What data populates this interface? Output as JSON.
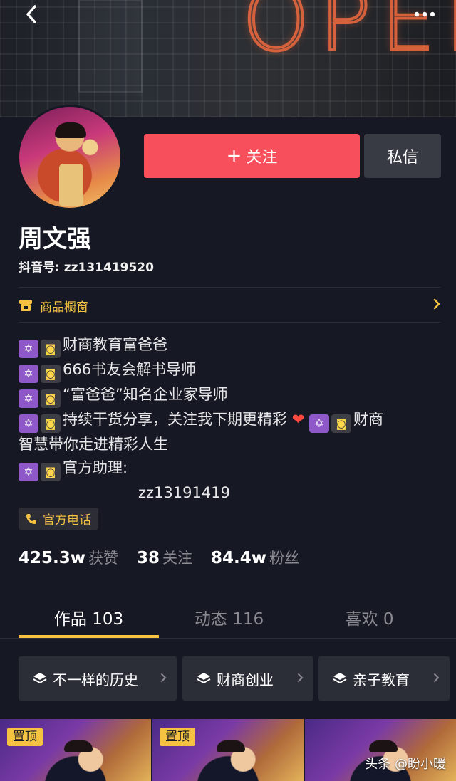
{
  "header": {
    "back_icon": "chevron-left-icon",
    "more_icon": "more-dots-icon"
  },
  "profile": {
    "follow_label": "关注",
    "message_label": "私信",
    "name": "周文强",
    "douyin_id": "抖音号: zz131419520"
  },
  "shop": {
    "label": "商品橱窗",
    "icon": "storefront-icon"
  },
  "bio": {
    "line1": "财商教育富爸爸",
    "line2": "666书友会解书导师",
    "line3": "“富爸爸”知名企业家导师",
    "line4": "持续干货分享，关注我下期更精彩",
    "line4b": "财商",
    "line5": "智慧带你走进精彩人生",
    "line6": "官方助理:",
    "line7": "zz13191419"
  },
  "phone_tag": {
    "label": "官方电话",
    "icon": "phone-icon"
  },
  "stats": {
    "likes_num": "425.3w",
    "likes_label": "获赞",
    "following_num": "38",
    "following_label": "关注",
    "followers_num": "84.4w",
    "followers_label": "粉丝"
  },
  "tabs": [
    {
      "label": "作品 103"
    },
    {
      "label": "动态 116"
    },
    {
      "label": "喜欢 0"
    }
  ],
  "collections": [
    {
      "label": "不一样的历史"
    },
    {
      "label": "财商创业"
    },
    {
      "label": "亲子教育"
    }
  ],
  "videos": {
    "pin_label": "置顶"
  },
  "watermark": "头条 @盼小暖",
  "colors": {
    "background": "#161823",
    "follow_button": "#f7505c",
    "accent_yellow": "#f5c242",
    "secondary_text": "#8a8b91"
  }
}
